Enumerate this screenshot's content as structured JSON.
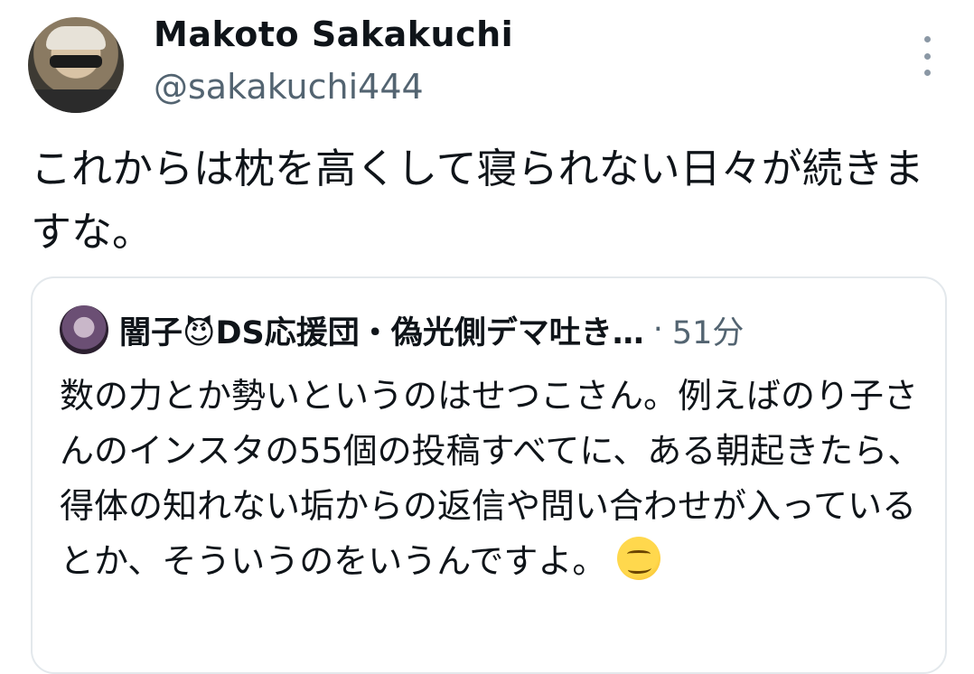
{
  "author": {
    "name": "Makoto Sakakuchi",
    "handle": "@sakakuchi444"
  },
  "tweet": {
    "text": "これからは枕を高くして寝られない日々が続きますな。"
  },
  "quoted": {
    "author_name": "闇子😈DS応援団・偽光側デマ吐き…",
    "separator": "·",
    "time": "51分",
    "text": "数の力とか勢いというのはせつこさん。例えばのり子さんのインスタの55個の投稿すべてに、ある朝起きたら、得体の知れない垢からの返信や問い合わせが入っているとか、そういうのをいうんですよ。",
    "emoji": "smirking-face"
  },
  "icons": {
    "more": "more-vertical-icon"
  }
}
